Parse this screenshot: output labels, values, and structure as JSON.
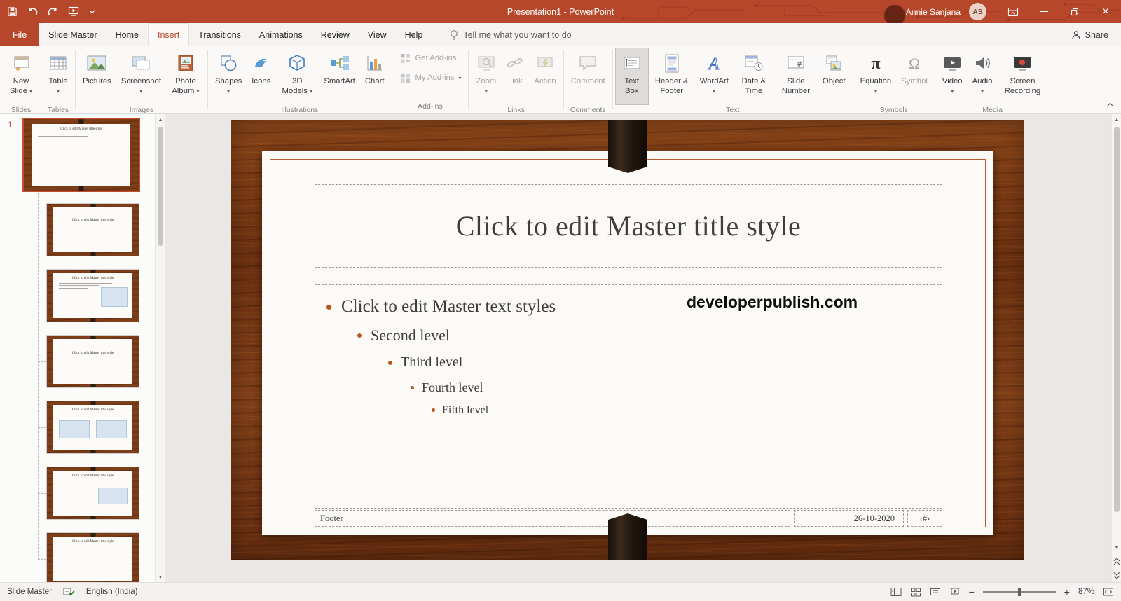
{
  "colors": {
    "accent": "#B7472A",
    "bullet": "#B8561C",
    "wood": "#7A3A16",
    "slide_border": "#BC5B28"
  },
  "titlebar": {
    "title": "Presentation1 - PowerPoint",
    "user_name": "Annie Sanjana",
    "avatar_initials": "AS"
  },
  "tabs": {
    "file": "File",
    "slide_master": "Slide Master",
    "home": "Home",
    "insert": "Insert",
    "transitions": "Transitions",
    "animations": "Animations",
    "review": "Review",
    "view": "View",
    "help": "Help",
    "tell_me": "Tell me what you want to do",
    "share": "Share"
  },
  "glyphs": {
    "dropdown": "▾",
    "scroll_up": "▲",
    "scroll_down": "▼",
    "close": "×",
    "zoom_out": "−",
    "zoom_in": "+",
    "pi": "π",
    "omega": "Ω",
    "hash": "#",
    "wordart_letter": "A"
  },
  "ribbon": {
    "slides": {
      "label": "Slides",
      "new_slide": "New Slide"
    },
    "tables": {
      "label": "Tables",
      "table": "Table"
    },
    "images": {
      "label": "Images",
      "pictures": "Pictures",
      "screenshot": "Screenshot",
      "photo_album": "Photo Album"
    },
    "illustrations": {
      "label": "Illustrations",
      "shapes": "Shapes",
      "icons": "Icons",
      "models": "3D Models",
      "smartart": "SmartArt",
      "chart": "Chart"
    },
    "addins": {
      "label": "Add-ins",
      "get_addins": "Get Add-ins",
      "my_addins": "My Add-ins"
    },
    "links": {
      "label": "Links",
      "zoom": "Zoom",
      "link": "Link",
      "action": "Action"
    },
    "comments": {
      "label": "Comments",
      "comment": "Comment"
    },
    "text": {
      "label": "Text",
      "text_box": "Text Box",
      "header_footer": "Header & Footer",
      "wordart": "WordArt",
      "date_time": "Date & Time",
      "slide_number": "Slide Number",
      "object": "Object"
    },
    "symbols": {
      "label": "Symbols",
      "equation": "Equation",
      "symbol": "Symbol"
    },
    "media": {
      "label": "Media",
      "video": "Video",
      "audio": "Audio",
      "screen_recording": "Screen Recording"
    }
  },
  "thumbnails": {
    "number": "1",
    "mini_title": "Click to edit Master title style"
  },
  "slide": {
    "title": "Click to edit Master title style",
    "bullet1": "Click to edit Master text styles",
    "bullet2": "Second level",
    "bullet3": "Third level",
    "bullet4": "Fourth level",
    "bullet5": "Fifth level",
    "watermark": "developerpublish.com",
    "footer": "Footer",
    "date": "26-10-2020",
    "slide_number": "‹#›"
  },
  "statusbar": {
    "view": "Slide Master",
    "language": "English (India)",
    "zoom": "87%"
  }
}
